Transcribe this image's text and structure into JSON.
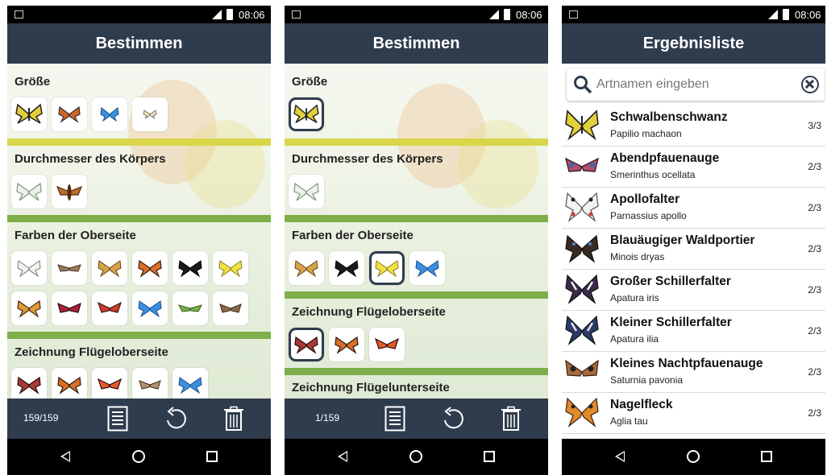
{
  "status": {
    "time": "08:06"
  },
  "screens": [
    {
      "title": "Bestimmen",
      "sections": [
        {
          "label": "Größe"
        },
        {
          "label": "Durchmesser des Körpers"
        },
        {
          "label": "Farben der Oberseite"
        },
        {
          "label": "Zeichnung Flügeloberseite"
        }
      ],
      "counter": "159/159",
      "icons": [
        "list-icon",
        "undo-icon",
        "trash-icon"
      ]
    },
    {
      "title": "Bestimmen",
      "sections": [
        {
          "label": "Größe"
        },
        {
          "label": "Durchmesser des Körpers"
        },
        {
          "label": "Farben der Oberseite"
        },
        {
          "label": "Zeichnung Flügeloberseite"
        },
        {
          "label": "Zeichnung Flügelunterseite"
        }
      ],
      "counter": "1/159",
      "icons": [
        "list-icon",
        "undo-icon",
        "trash-icon"
      ]
    },
    {
      "title": "Ergebnisliste",
      "search_placeholder": "Artnamen eingeben",
      "results": [
        {
          "name": "Schwalbenschwanz",
          "latin": "Papilio machaon",
          "score": "3/3"
        },
        {
          "name": "Abendpfauenauge",
          "latin": "Smerinthus ocellata",
          "score": "2/3"
        },
        {
          "name": "Apollofalter",
          "latin": "Parnassius apollo",
          "score": "2/3"
        },
        {
          "name": "Blauäugiger Waldportier",
          "latin": "Minois dryas",
          "score": "2/3"
        },
        {
          "name": "Großer Schillerfalter",
          "latin": "Apatura iris",
          "score": "2/3"
        },
        {
          "name": "Kleiner Schillerfalter",
          "latin": "Apatura ilia",
          "score": "2/3"
        },
        {
          "name": "Kleines Nachtpfauenauge",
          "latin": "Saturnia pavonia",
          "score": "2/3"
        },
        {
          "name": "Nagelfleck",
          "latin": "Aglia tau",
          "score": "2/3"
        }
      ]
    }
  ],
  "colors": {
    "appbar": "#2f3c4e",
    "accent_stripe_yellow": "#d9d64a",
    "accent_stripe_green": "#7fae4a"
  }
}
